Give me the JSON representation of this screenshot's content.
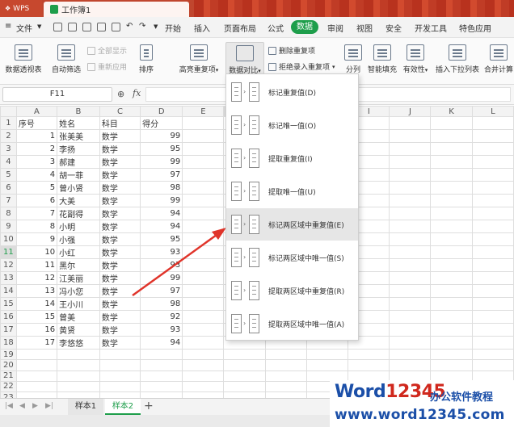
{
  "titlebar": {
    "app": "WPS",
    "doc_tab": "工作簿1"
  },
  "menubar": {
    "file": "文件",
    "items": [
      "开始",
      "插入",
      "页面布局",
      "公式",
      "数据",
      "审阅",
      "视图",
      "安全",
      "开发工具",
      "特色应用"
    ],
    "active": "数据"
  },
  "ribbon": {
    "pivot": "数据透视表",
    "autofilter": "自动筛选",
    "show_all": "全部显示",
    "reapply": "重新应用",
    "sort_label": "排序",
    "highlight_dup": "高亮重复项",
    "compare": "数据对比",
    "delete_dup": "删除重复项",
    "reject_dup": "拒绝录入重复项",
    "split": "分列",
    "smart_fill": "智能填充",
    "validity": "有效性",
    "dropdown_list": "插入下拉列表",
    "merge_calc": "合并计算"
  },
  "formulabar": {
    "cell_ref": "F11",
    "fx": "fx"
  },
  "grid": {
    "columns": [
      "A",
      "B",
      "C",
      "D",
      "E",
      "F",
      "G",
      "H",
      "I",
      "J",
      "K",
      "L"
    ],
    "selected_row": "11",
    "headers": [
      "序号",
      "姓名",
      "科目",
      "得分"
    ],
    "rows": [
      [
        "1",
        "张美美",
        "数学",
        "99"
      ],
      [
        "2",
        "李扬",
        "数学",
        "95"
      ],
      [
        "3",
        "郝建",
        "数学",
        "99"
      ],
      [
        "4",
        "胡一菲",
        "数学",
        "97"
      ],
      [
        "5",
        "曾小贤",
        "数学",
        "98"
      ],
      [
        "6",
        "大美",
        "数学",
        "99"
      ],
      [
        "7",
        "花副得",
        "数学",
        "94"
      ],
      [
        "8",
        "小明",
        "数学",
        "94"
      ],
      [
        "9",
        "小强",
        "数学",
        "95"
      ],
      [
        "10",
        "小红",
        "数学",
        "93"
      ],
      [
        "11",
        "黑尔",
        "数学",
        "93"
      ],
      [
        "12",
        "江美丽",
        "数学",
        "99"
      ],
      [
        "13",
        "冯小您",
        "数学",
        "97"
      ],
      [
        "14",
        "王小川",
        "数学",
        "98"
      ],
      [
        "15",
        "曾美",
        "数学",
        "92"
      ],
      [
        "16",
        "黄贤",
        "数学",
        "93"
      ],
      [
        "17",
        "李悠悠",
        "数学",
        "94"
      ]
    ]
  },
  "dropdown": {
    "items": [
      "标记重复值(D)",
      "标记唯一值(O)",
      "提取重复值(I)",
      "提取唯一值(U)",
      "标记两区域中重复值(E)",
      "标记两区域中唯一值(S)",
      "提取两区域中重复值(R)",
      "提取两区域中唯一值(A)"
    ],
    "highlighted_index": 4
  },
  "sheets": {
    "tabs": [
      "样本1",
      "样本2"
    ],
    "active": "样本2",
    "add": "+"
  },
  "watermark": {
    "brand_blue": "Word",
    "brand_red": "12345",
    "sub": "办公软件教程",
    "url": "www.word12345.com"
  },
  "colors": {
    "accent": "#1e9e4b",
    "title_bar": "#c0462e",
    "arrow": "#e0342a",
    "watermark_blue": "#1b4fa8",
    "watermark_red": "#d0281d"
  }
}
